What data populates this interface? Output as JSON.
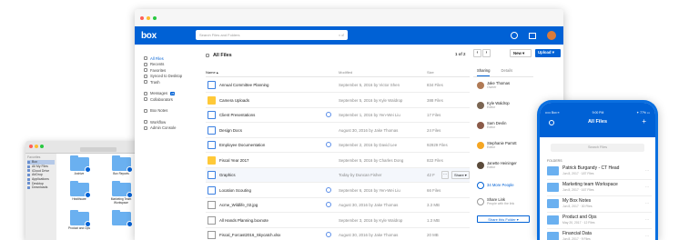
{
  "colors": {
    "brand": "#0061d5",
    "folder": "#ffc938",
    "mac_folder": "#6ab0f0"
  },
  "app": {
    "logo": "box",
    "search_placeholder": "Search Files and Folders",
    "search_clear": "× ☌"
  },
  "sidebar": {
    "items": [
      {
        "label": "All Files",
        "icon": "folder-icon"
      },
      {
        "label": "Recents",
        "icon": "clock-icon"
      },
      {
        "label": "Favorites",
        "icon": "star-icon"
      },
      {
        "label": "Synced to Desktop",
        "icon": "sync-icon"
      },
      {
        "label": "Trash",
        "icon": "trash-icon"
      }
    ],
    "items2": [
      {
        "label": "Messages",
        "badge": "26",
        "icon": "message-icon"
      },
      {
        "label": "Collaborators",
        "icon": "people-icon"
      }
    ],
    "items3": [
      {
        "label": "Box Notes",
        "icon": "notes-icon"
      }
    ],
    "items4": [
      {
        "label": "Workflow",
        "icon": "workflow-icon"
      },
      {
        "label": "Admin Console",
        "icon": "admin-icon"
      }
    ]
  },
  "header": {
    "title": "All Files",
    "page": "1 of 2",
    "prev": "‹",
    "next": "›",
    "new_label": "New ▾",
    "upload_label": "Upload ▾"
  },
  "columns": {
    "name": "Name ▴",
    "modified": "Modified",
    "size": "Size"
  },
  "files": [
    {
      "name": "Annual Committee Planning",
      "modified": "September 5, 2016 by Victor Shen",
      "size": "834 Files",
      "type": "folder-collab"
    },
    {
      "name": "Camera Uploads",
      "modified": "September 5, 2016 by Kyle Waldrop",
      "size": "388 Files",
      "type": "folder"
    },
    {
      "name": "Client Presentations",
      "modified": "September 1, 2016 by Yen-Wei Liu",
      "size": "17 Files",
      "type": "folder-collab",
      "collab": true
    },
    {
      "name": "Design Docs",
      "modified": "August 30, 2016 by Jake Thomas",
      "size": "24 Files",
      "type": "folder-collab"
    },
    {
      "name": "Employee Documentation",
      "modified": "September 2, 2016 by David Lee",
      "size": "92929 Files",
      "type": "folder-collab",
      "collab": true
    },
    {
      "name": "Fiscal Year 2017",
      "modified": "September 5, 2016 by Charles Dong",
      "size": "822 Files",
      "type": "folder"
    },
    {
      "name": "Graphics",
      "modified": "Today by Duncan Fisher",
      "size": "42 F",
      "type": "folder-collab",
      "hover": true
    },
    {
      "name": "Location Scouting",
      "modified": "September 6, 2016 by Yen-Wei Liu",
      "size": "66 Files",
      "type": "folder-collab",
      "collab": true
    },
    {
      "name": "Acme_Wildlife_02.jpg",
      "modified": "August 30, 2016 by Jake Thomas",
      "size": "3.3 MB",
      "type": "file",
      "collab": true
    },
    {
      "name": "All Hands Planning.boxnote",
      "modified": "September 3, 2016 by Kyle Waldrop",
      "size": "1.3 MB",
      "type": "file"
    },
    {
      "name": "Fiscal_Forcast2016_Skycatch.xlsx",
      "modified": "August 30, 2016 by Jake Thomas",
      "size": "20 MB",
      "type": "file",
      "collab": true
    }
  ],
  "row_actions": {
    "more": "···",
    "share": "Share ▾"
  },
  "right_panel": {
    "tabs": [
      "Sharing",
      "Details"
    ],
    "people": [
      {
        "name": "Jake Thomas",
        "role": "Owner",
        "color": "#b07a55"
      },
      {
        "name": "Kyle Waldrop",
        "role": "Editor",
        "color": "#7a6552"
      },
      {
        "name": "Sam Devlin",
        "role": "Editor",
        "color": "#8a5a48"
      },
      {
        "name": "Stephanie Parrott",
        "role": "Editor",
        "color": "#f5a623"
      },
      {
        "name": "Janette Heininger",
        "role": "Editor",
        "color": "#5a4a3a"
      }
    ],
    "more_people": "34 More People",
    "share_link": "Share Link",
    "share_link_sub": "People with the link",
    "share_folder": "Share this Folder ▾"
  },
  "finder": {
    "favorites_label": "Favorites",
    "side": [
      "Box",
      "All My Files",
      "iCloud Drive",
      "AirDrop",
      "Applications",
      "Desktop",
      "Downloads"
    ],
    "folders": [
      "Archive",
      "Box Reports",
      "Healthcare",
      "Marketing Team Workspace",
      "Product and Ops",
      ""
    ]
  },
  "phone": {
    "carrier": "••••• Box ≡",
    "time": "9:00 PM",
    "battery": "✦ 77% ▭",
    "title": "All Files",
    "search": "Search Files",
    "folders_label": "FOLDERS",
    "rows": [
      {
        "name": "Patrick Burgandy - CT Head",
        "date": "Jun 8, 2017 · 187 Files"
      },
      {
        "name": "Marketing team Workspace",
        "date": "Jun 8, 2017 · 167 Files"
      },
      {
        "name": "My Box Notes",
        "date": "Jun 8, 2017 · 30 Files"
      },
      {
        "name": "Product and Ops",
        "date": "May 20, 2017 · 12 Files"
      },
      {
        "name": "Financial Data",
        "date": "Jun 8, 2017 · 9 Files"
      }
    ]
  }
}
